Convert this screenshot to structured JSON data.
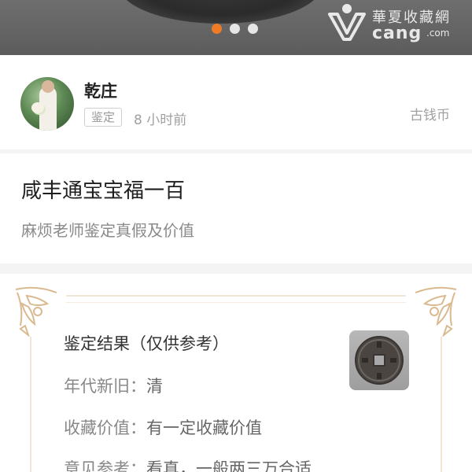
{
  "banner": {
    "carousel_dots": 3,
    "active_index": 0,
    "watermark": {
      "chinese": "華夏收藏網",
      "english": "cang",
      "domain": ".com"
    },
    "accent_color": "#f07a26"
  },
  "user": {
    "name": "乾庄",
    "tag": "鉴定",
    "time": "8 小时前",
    "category": "古钱币"
  },
  "post": {
    "title": "咸丰通宝宝福一百",
    "subtitle": "麻烦老师鉴定真假及价值"
  },
  "appraisal": {
    "heading": "鉴定结果（仅供参考）",
    "rows": [
      {
        "label": "年代新旧：",
        "value": "清"
      },
      {
        "label": "收藏价值：",
        "value": "有一定收藏价值"
      },
      {
        "label": "意见参考：",
        "value": "看真，一般两三万合适"
      }
    ]
  }
}
